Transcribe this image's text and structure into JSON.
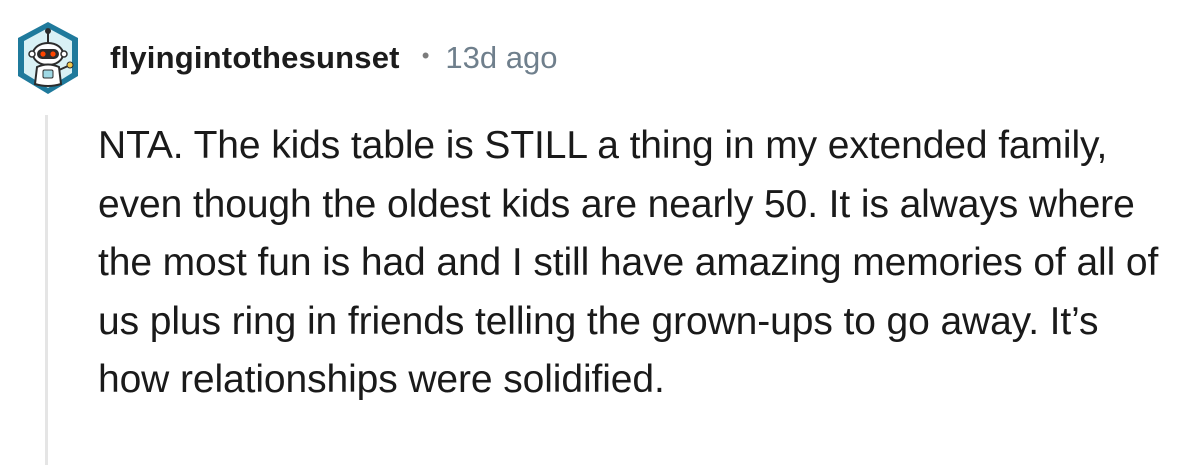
{
  "comment": {
    "author": "flyingintothesunset",
    "separator": "•",
    "timestamp": "13d ago",
    "avatar_icon": "snoo-robot-avatar-icon",
    "body": "NTA. The kids table is STILL a thing in my extended family, even though the oldest kids are nearly 50. It is always where the most fun is had and I still have amazing memories of all of us plus ring in friends telling the grown-ups to go away. It’s how relationships were solidified."
  },
  "colors": {
    "avatar_ring": "#1f7a9c",
    "avatar_inner": "#d9f1f5",
    "thread_line": "#e5e5e5",
    "timestamp": "#6f7f8c"
  }
}
